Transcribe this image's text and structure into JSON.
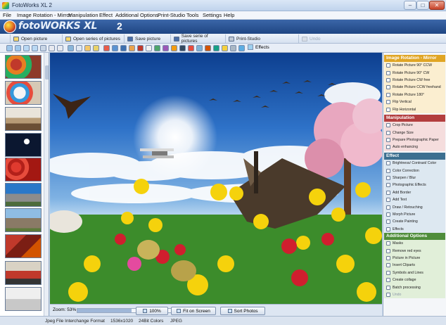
{
  "window": {
    "title": "FotoWorks XL 2",
    "min_glyph": "–",
    "max_glyph": "□",
    "close_glyph": "✕"
  },
  "menu": [
    "File",
    "Image Rotation - Mirror",
    "Manipulation",
    "Effect",
    "Additional Options",
    "Print-Studio",
    "Tools",
    "Settings",
    "Help"
  ],
  "banner": {
    "logo_text": "fotoWORKS XL",
    "version": "2"
  },
  "actions": {
    "open_picture": "Open picture",
    "open_series": "Open series of pictures",
    "save_picture": "Save picture",
    "save_series": "Save serie of pictures",
    "print_studio": "Print-Studio",
    "undo": "Undo"
  },
  "toolbar": {
    "effects_label": "Effects"
  },
  "zoom": {
    "label": "Zoom: 53%",
    "value": 0.53,
    "btn_100": "100%",
    "btn_fit": "Fit on Screen",
    "btn_sort": "Sort Photos"
  },
  "status": {
    "format": "Jpeg File Interchange Format",
    "dimensions": "1536x1020",
    "colors": "24Bit Colors",
    "type": "JPEG"
  },
  "panel": {
    "rotation": {
      "title": "Image Rotation - Mirror",
      "items": [
        "Rotate Picture 90° CCW",
        "Rotate Picture 90° CW",
        "Rotate Picture CW free",
        "Rotate Picture CCW freehand",
        "Rotate Picture 180°",
        "Flip Vertical",
        "Flip Horizontal"
      ]
    },
    "manipulation": {
      "title": "Manipulation",
      "items": [
        "Crop Picture",
        "Change Size",
        "Prepare Photographic Paper",
        "Auto enhancing"
      ]
    },
    "effect": {
      "title": "Effect",
      "items": [
        "Brightness/ Contrast/ Color",
        "Color Correction",
        "Sharpen / Blur",
        "Photographic Effects",
        "Add Border",
        "Add Text",
        "Draw / Retouching",
        "Morph Picture",
        "Create Painting",
        "Effects"
      ]
    },
    "additional": {
      "title": "Additional Options",
      "items": [
        "Masks",
        "Remove red eyes",
        "Picture in Picture",
        "Insert Cliparts",
        "Symbols and Lines",
        "Create collage",
        "Batch processing"
      ],
      "undo": "Undo"
    }
  },
  "colors": {
    "rotation_head": "#e0a524",
    "manipulation_head": "#b33e3e",
    "effect_head": "#3c6f90",
    "additional_head": "#4f8d3b",
    "banner": "#2a5596"
  }
}
